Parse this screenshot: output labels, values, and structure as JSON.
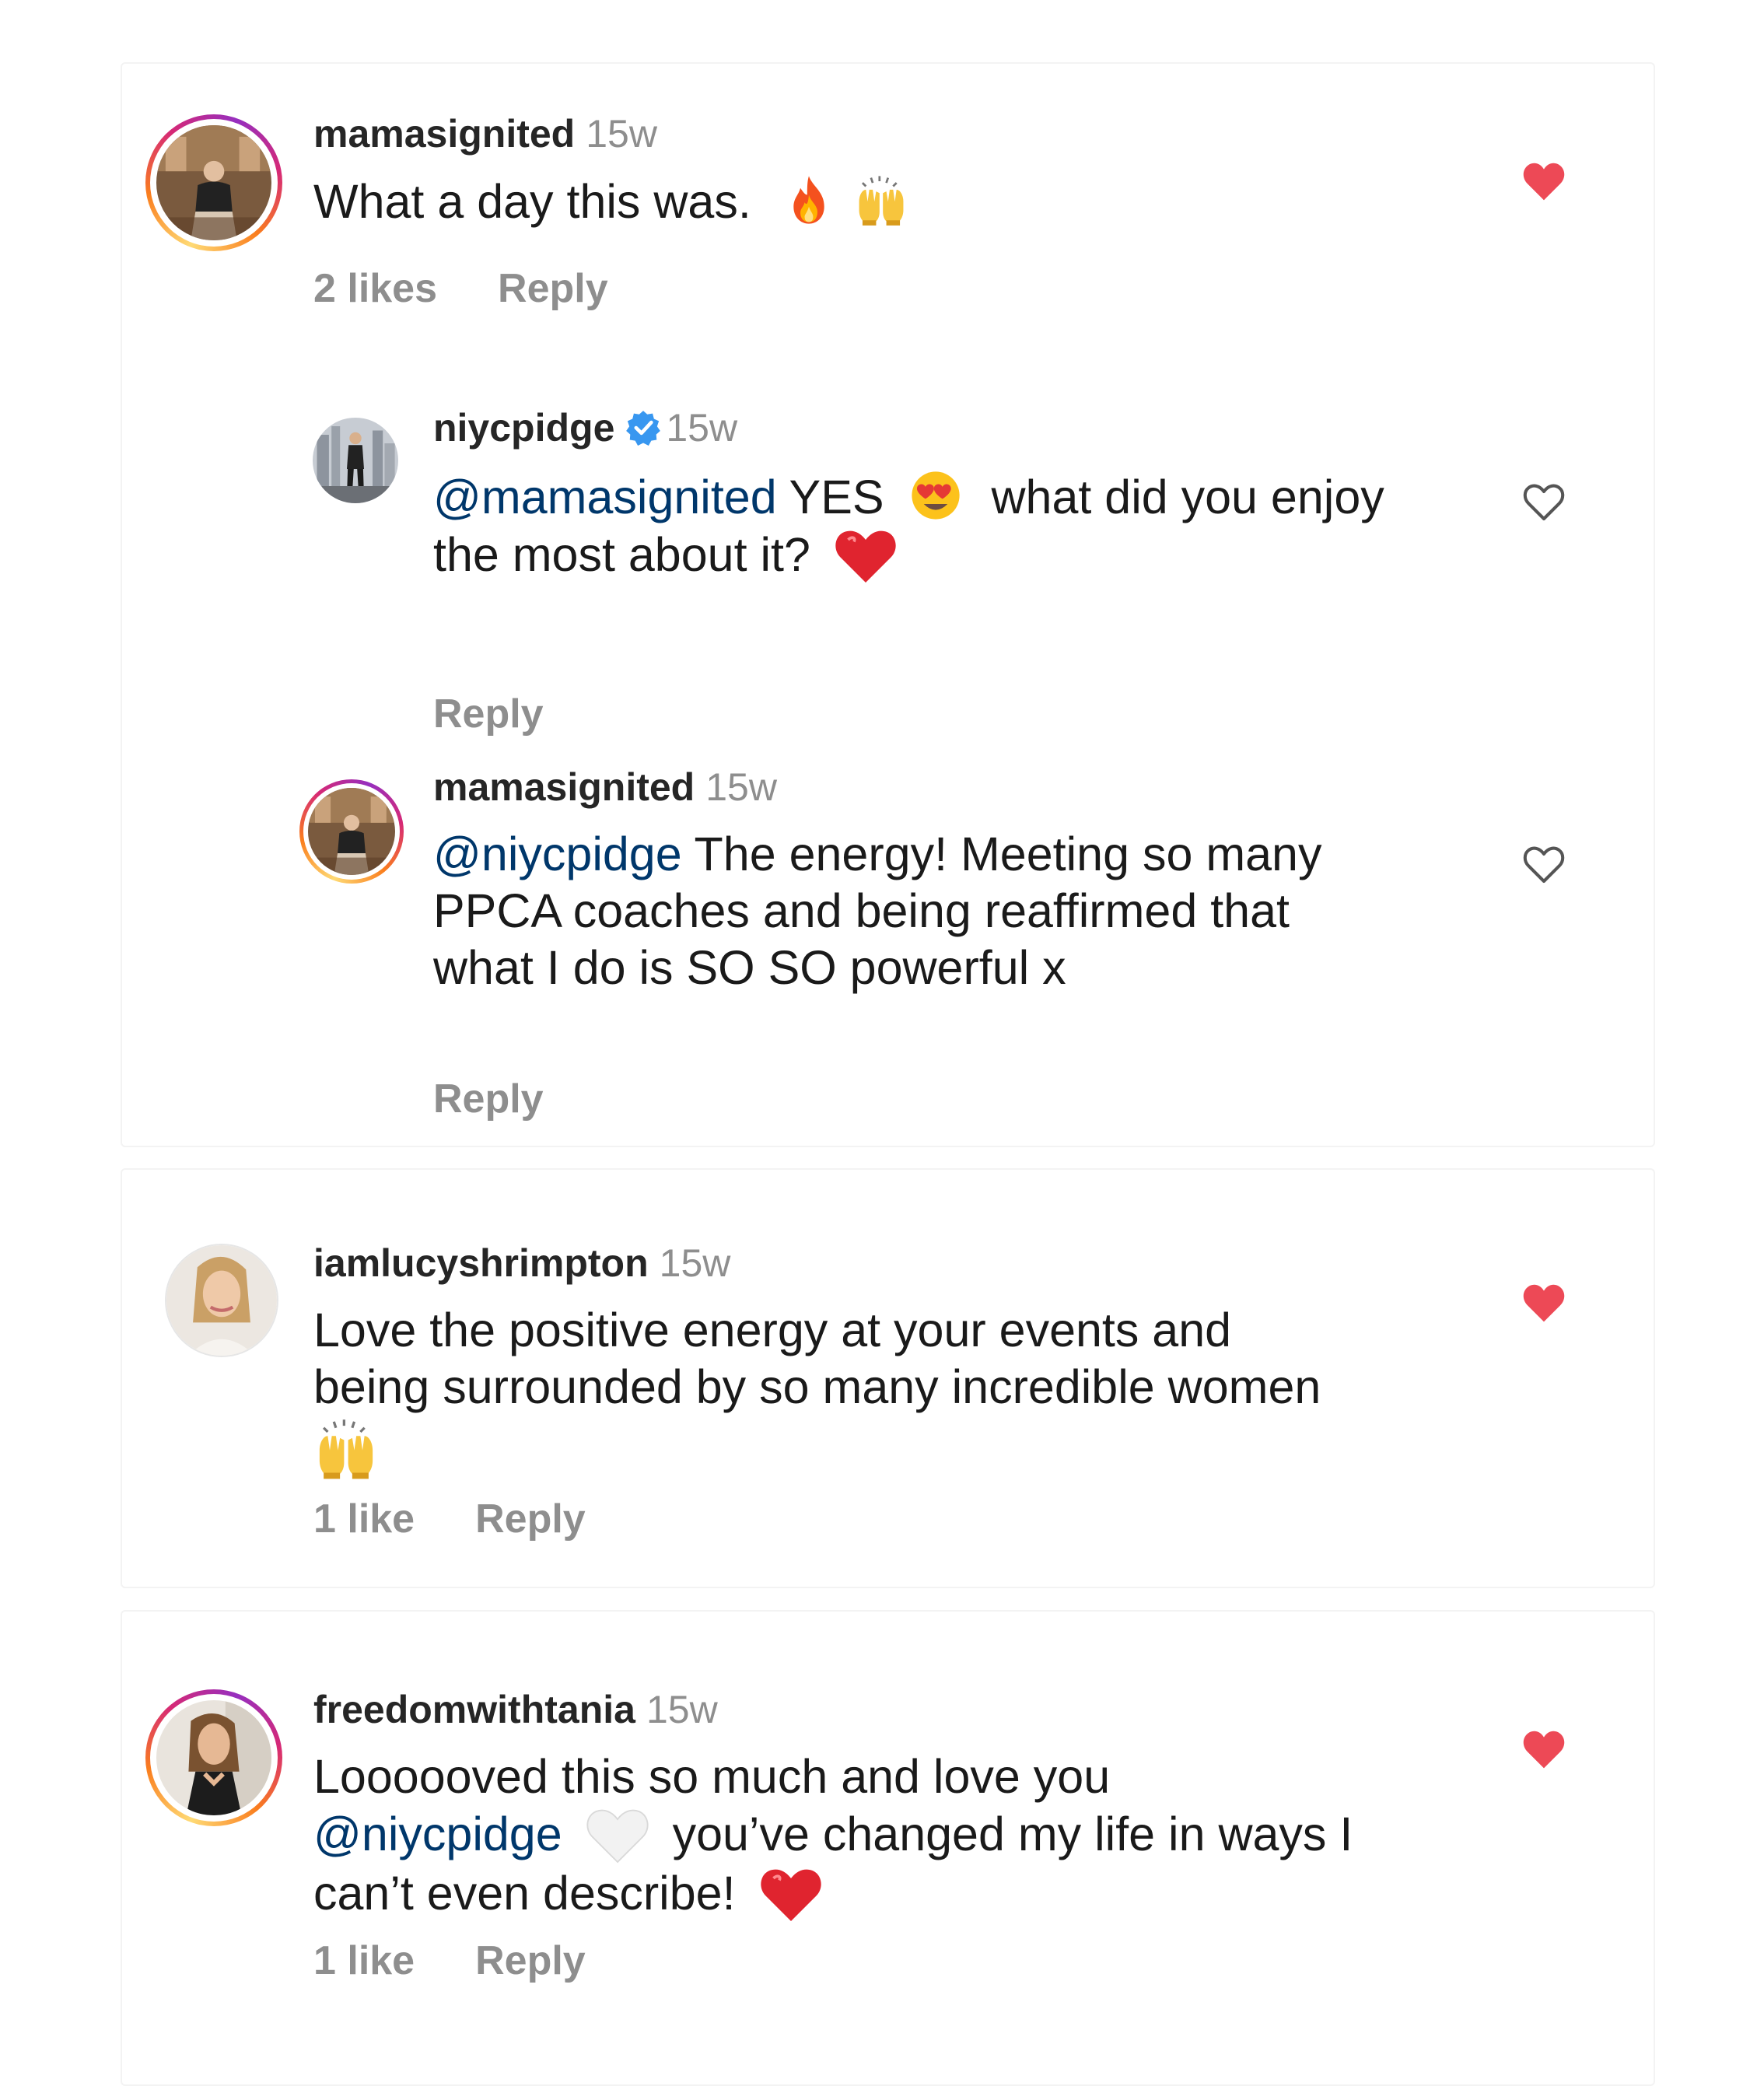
{
  "colors": {
    "like_red": "#ed4956",
    "mention_blue": "#00376b",
    "muted_gray": "#8e8e8e",
    "verified_blue": "#3897f0"
  },
  "comments": [
    {
      "username": "mamasignited",
      "time": "15w",
      "text": "What a day this was.",
      "emojis": [
        "fire-emoji",
        "raising-hands-emoji"
      ],
      "likes": "2 likes",
      "reply": "Reply",
      "liked": true,
      "replies": [
        {
          "username": "niycpidge",
          "verified": true,
          "time": "15w",
          "mention": "@mamasignited",
          "text_part1": "YES",
          "text_part2": "what did you enjoy",
          "text_part3": "the most about it?",
          "emojis": [
            "heart-eyes-emoji",
            "red-heart-emoji"
          ],
          "reply": "Reply",
          "liked": false
        },
        {
          "username": "mamasignited",
          "time": "15w",
          "mention": "@niycpidge",
          "text_line1": "The energy! Meeting so many",
          "text_line2": "PPCA coaches and being reaffirmed that",
          "text_line3": "what I do is SO SO powerful x",
          "reply": "Reply",
          "liked": false
        }
      ]
    },
    {
      "username": "iamlucyshrimpton",
      "time": "15w",
      "text_line1": "Love the positive energy at your events and",
      "text_line2": "being surrounded by so many incredible women",
      "emojis": [
        "raising-hands-emoji"
      ],
      "likes": "1 like",
      "reply": "Reply",
      "liked": true
    },
    {
      "username": "freedomwithtania",
      "time": "15w",
      "text_line1": "Loooooved this so much and love you",
      "mention": "@niycpidge",
      "text_line2": "you’ve changed my life in ways I",
      "text_line3": "can’t even describe!",
      "emojis": [
        "white-heart-emoji",
        "red-heart-emoji"
      ],
      "likes": "1 like",
      "reply": "Reply",
      "liked": true
    }
  ]
}
